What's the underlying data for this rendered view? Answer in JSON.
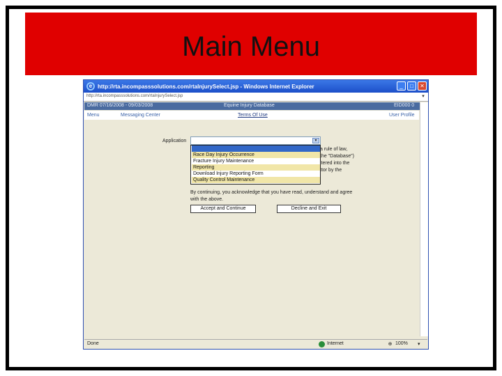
{
  "slide": {
    "title": "Main Menu",
    "accent_color": "#e00000"
  },
  "window": {
    "title": "http://rta.incompasssolutions.com/rtaInjurySelect.jsp - Windows Internet Explorer",
    "address": "http://rta.incompasssolutions.com/rtaInjurySelect.jsp",
    "buttons": {
      "minimize": "_",
      "maximize": "□",
      "close": "✕"
    }
  },
  "app_header": {
    "left": "DMR 07/16/2008 - 09/03/2008",
    "center": "Equine Injury Database",
    "right": "EID000 0",
    "close": "X"
  },
  "nav": {
    "menu": "Menu",
    "messaging_center": "Messaging Center",
    "terms_of_use": "Terms Of Use",
    "user_profile": "User Profile"
  },
  "form": {
    "application_label": "Application",
    "dropdown_options": [
      "",
      "Race Day Injury Occurrence",
      "Fracture Injury Maintenance",
      "Reporting",
      "Download Injury Reporting Form",
      "Quality Control Maintenance"
    ],
    "description_lines": [
      "a rule of law,",
      "the \"Database\")",
      "itered into the",
      "ttor by the"
    ],
    "acknowledgement": "By continuing, you acknowledge that you have read, understand and agree with the above.",
    "accept_button": "Accept and Continue",
    "decline_button": "Decline and Exit"
  },
  "status_bar": {
    "left": "Done",
    "zone": "Internet",
    "zoom": "100%"
  }
}
